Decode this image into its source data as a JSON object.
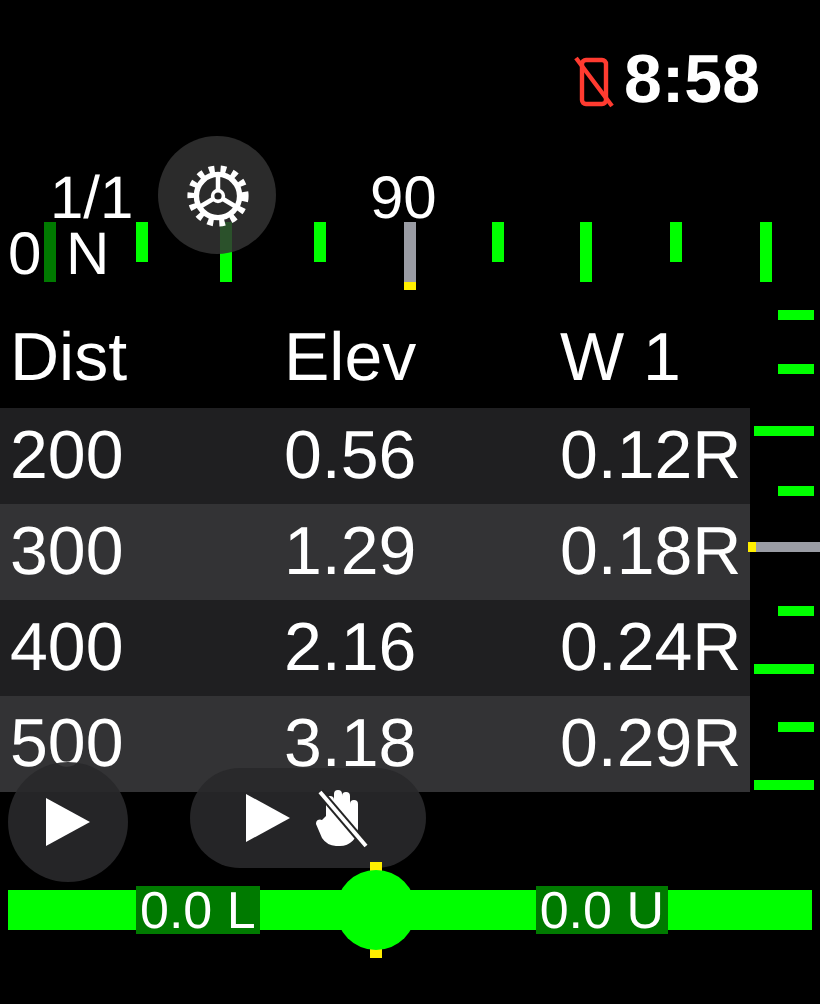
{
  "status_bar": {
    "time": "8:58"
  },
  "compass": {
    "count": "1/1",
    "left_value": "0",
    "left_direction": "N",
    "center_label": "90"
  },
  "table": {
    "columns": [
      "Dist",
      "Elev",
      "W 1"
    ],
    "rows": [
      [
        "200",
        "0.56",
        "0.12R"
      ],
      [
        "300",
        "1.29",
        "0.18R"
      ],
      [
        "400",
        "2.16",
        "0.24R"
      ],
      [
        "500",
        "3.18",
        "0.29R"
      ]
    ]
  },
  "readouts": {
    "left": "0.0 L",
    "right": "0.0 U"
  }
}
